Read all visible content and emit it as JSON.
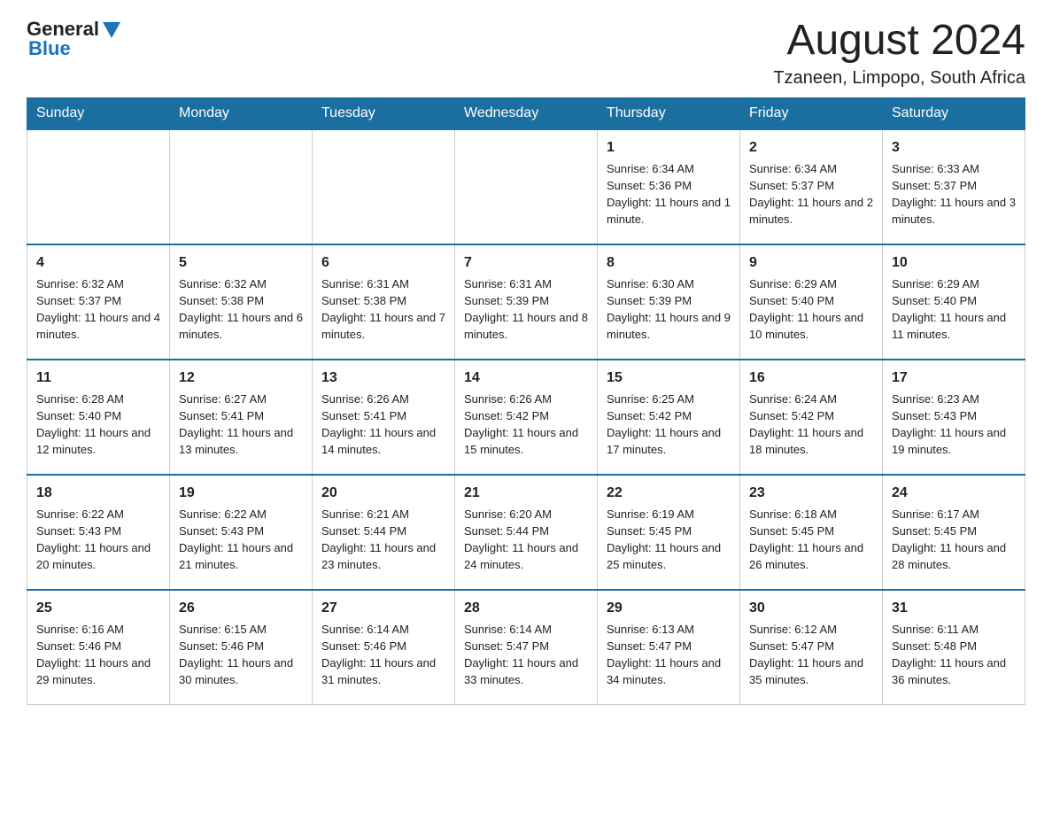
{
  "header": {
    "logo_general": "General",
    "logo_blue": "Blue",
    "month_year": "August 2024",
    "location": "Tzaneen, Limpopo, South Africa"
  },
  "days_of_week": [
    "Sunday",
    "Monday",
    "Tuesday",
    "Wednesday",
    "Thursday",
    "Friday",
    "Saturday"
  ],
  "weeks": [
    [
      {
        "day": "",
        "info": ""
      },
      {
        "day": "",
        "info": ""
      },
      {
        "day": "",
        "info": ""
      },
      {
        "day": "",
        "info": ""
      },
      {
        "day": "1",
        "info": "Sunrise: 6:34 AM\nSunset: 5:36 PM\nDaylight: 11 hours and 1 minute."
      },
      {
        "day": "2",
        "info": "Sunrise: 6:34 AM\nSunset: 5:37 PM\nDaylight: 11 hours and 2 minutes."
      },
      {
        "day": "3",
        "info": "Sunrise: 6:33 AM\nSunset: 5:37 PM\nDaylight: 11 hours and 3 minutes."
      }
    ],
    [
      {
        "day": "4",
        "info": "Sunrise: 6:32 AM\nSunset: 5:37 PM\nDaylight: 11 hours and 4 minutes."
      },
      {
        "day": "5",
        "info": "Sunrise: 6:32 AM\nSunset: 5:38 PM\nDaylight: 11 hours and 6 minutes."
      },
      {
        "day": "6",
        "info": "Sunrise: 6:31 AM\nSunset: 5:38 PM\nDaylight: 11 hours and 7 minutes."
      },
      {
        "day": "7",
        "info": "Sunrise: 6:31 AM\nSunset: 5:39 PM\nDaylight: 11 hours and 8 minutes."
      },
      {
        "day": "8",
        "info": "Sunrise: 6:30 AM\nSunset: 5:39 PM\nDaylight: 11 hours and 9 minutes."
      },
      {
        "day": "9",
        "info": "Sunrise: 6:29 AM\nSunset: 5:40 PM\nDaylight: 11 hours and 10 minutes."
      },
      {
        "day": "10",
        "info": "Sunrise: 6:29 AM\nSunset: 5:40 PM\nDaylight: 11 hours and 11 minutes."
      }
    ],
    [
      {
        "day": "11",
        "info": "Sunrise: 6:28 AM\nSunset: 5:40 PM\nDaylight: 11 hours and 12 minutes."
      },
      {
        "day": "12",
        "info": "Sunrise: 6:27 AM\nSunset: 5:41 PM\nDaylight: 11 hours and 13 minutes."
      },
      {
        "day": "13",
        "info": "Sunrise: 6:26 AM\nSunset: 5:41 PM\nDaylight: 11 hours and 14 minutes."
      },
      {
        "day": "14",
        "info": "Sunrise: 6:26 AM\nSunset: 5:42 PM\nDaylight: 11 hours and 15 minutes."
      },
      {
        "day": "15",
        "info": "Sunrise: 6:25 AM\nSunset: 5:42 PM\nDaylight: 11 hours and 17 minutes."
      },
      {
        "day": "16",
        "info": "Sunrise: 6:24 AM\nSunset: 5:42 PM\nDaylight: 11 hours and 18 minutes."
      },
      {
        "day": "17",
        "info": "Sunrise: 6:23 AM\nSunset: 5:43 PM\nDaylight: 11 hours and 19 minutes."
      }
    ],
    [
      {
        "day": "18",
        "info": "Sunrise: 6:22 AM\nSunset: 5:43 PM\nDaylight: 11 hours and 20 minutes."
      },
      {
        "day": "19",
        "info": "Sunrise: 6:22 AM\nSunset: 5:43 PM\nDaylight: 11 hours and 21 minutes."
      },
      {
        "day": "20",
        "info": "Sunrise: 6:21 AM\nSunset: 5:44 PM\nDaylight: 11 hours and 23 minutes."
      },
      {
        "day": "21",
        "info": "Sunrise: 6:20 AM\nSunset: 5:44 PM\nDaylight: 11 hours and 24 minutes."
      },
      {
        "day": "22",
        "info": "Sunrise: 6:19 AM\nSunset: 5:45 PM\nDaylight: 11 hours and 25 minutes."
      },
      {
        "day": "23",
        "info": "Sunrise: 6:18 AM\nSunset: 5:45 PM\nDaylight: 11 hours and 26 minutes."
      },
      {
        "day": "24",
        "info": "Sunrise: 6:17 AM\nSunset: 5:45 PM\nDaylight: 11 hours and 28 minutes."
      }
    ],
    [
      {
        "day": "25",
        "info": "Sunrise: 6:16 AM\nSunset: 5:46 PM\nDaylight: 11 hours and 29 minutes."
      },
      {
        "day": "26",
        "info": "Sunrise: 6:15 AM\nSunset: 5:46 PM\nDaylight: 11 hours and 30 minutes."
      },
      {
        "day": "27",
        "info": "Sunrise: 6:14 AM\nSunset: 5:46 PM\nDaylight: 11 hours and 31 minutes."
      },
      {
        "day": "28",
        "info": "Sunrise: 6:14 AM\nSunset: 5:47 PM\nDaylight: 11 hours and 33 minutes."
      },
      {
        "day": "29",
        "info": "Sunrise: 6:13 AM\nSunset: 5:47 PM\nDaylight: 11 hours and 34 minutes."
      },
      {
        "day": "30",
        "info": "Sunrise: 6:12 AM\nSunset: 5:47 PM\nDaylight: 11 hours and 35 minutes."
      },
      {
        "day": "31",
        "info": "Sunrise: 6:11 AM\nSunset: 5:48 PM\nDaylight: 11 hours and 36 minutes."
      }
    ]
  ]
}
